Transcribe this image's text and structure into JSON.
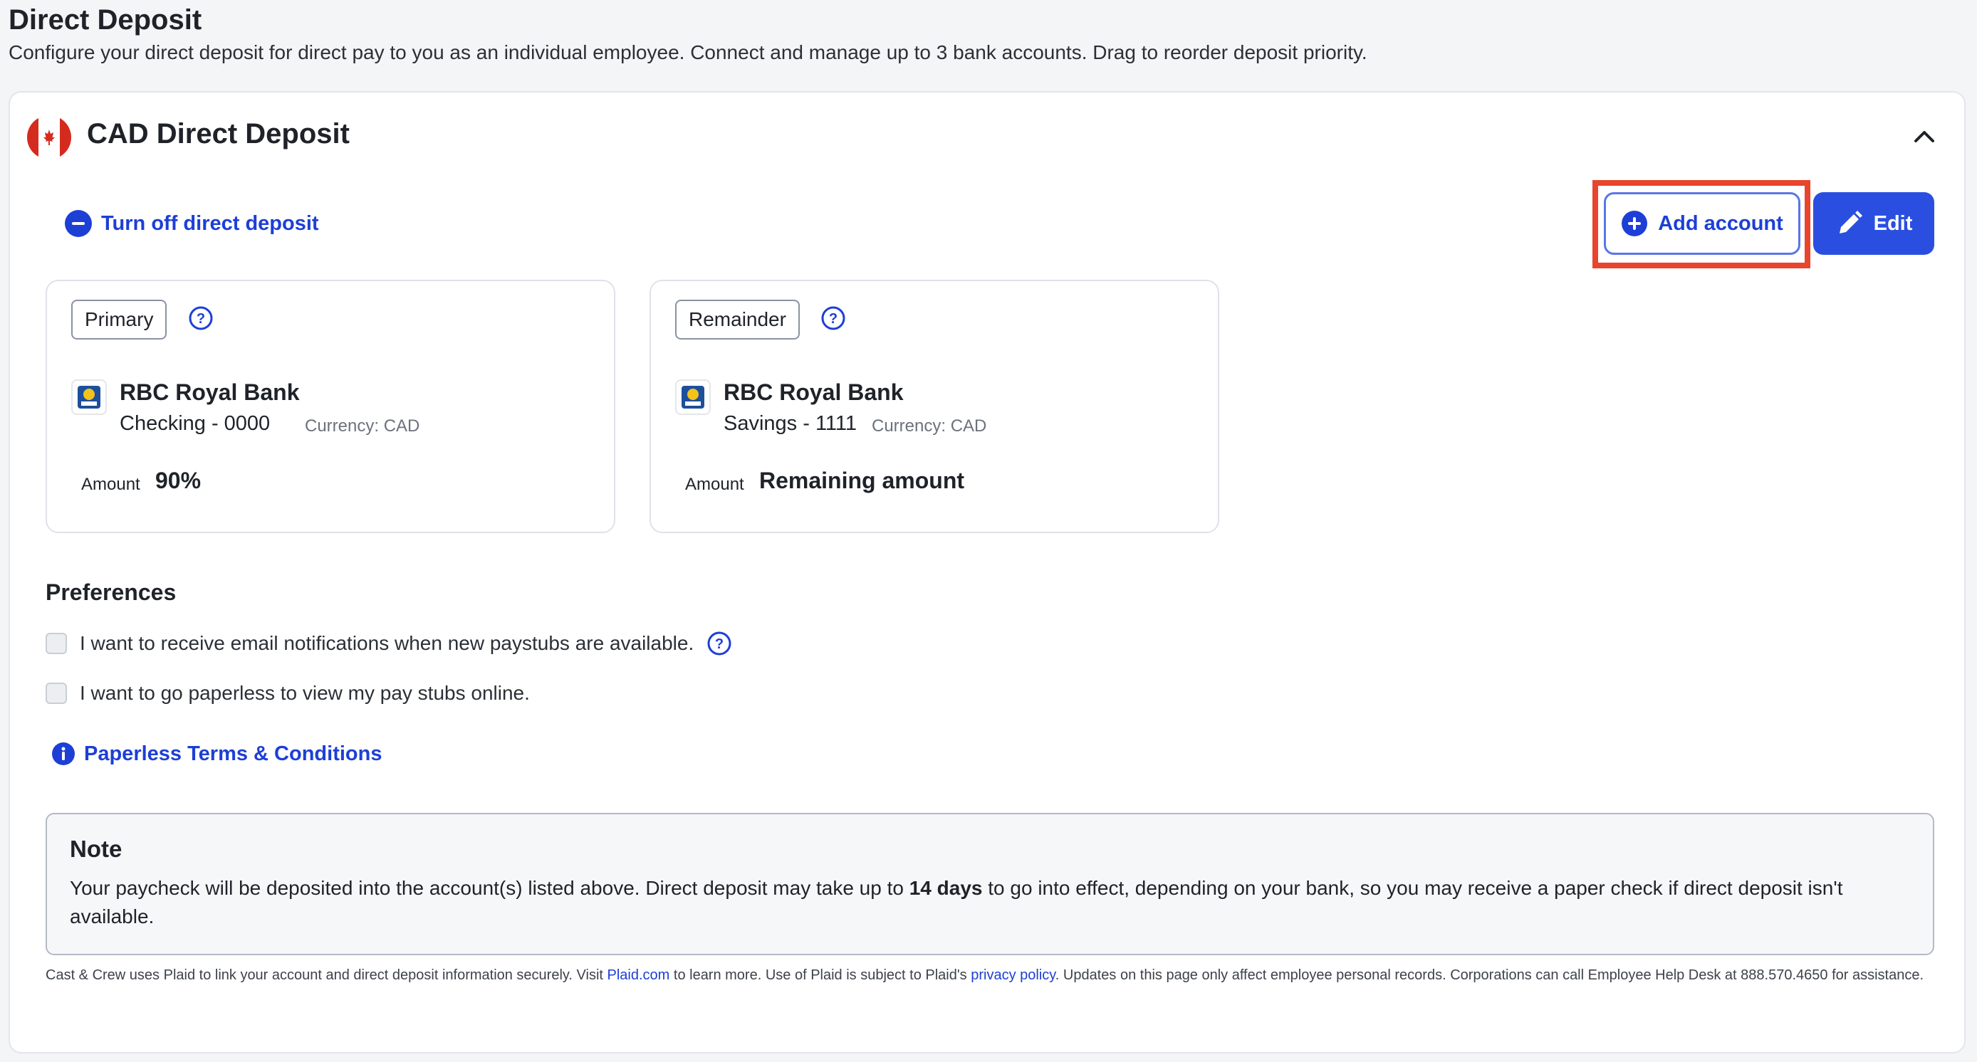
{
  "page": {
    "title": "Direct Deposit",
    "subtitle": "Configure your direct deposit for direct pay to you as an individual employee. Connect and manage up to 3 bank accounts. Drag to reorder deposit priority."
  },
  "section": {
    "title": "CAD Direct Deposit",
    "turn_off_label": "Turn off direct deposit",
    "add_account_label": "Add account",
    "edit_label": "Edit"
  },
  "accounts": [
    {
      "tag": "Primary",
      "bank_name": "RBC Royal Bank",
      "account": "Checking - 0000",
      "currency": "Currency: CAD",
      "amount_label": "Amount",
      "amount_value": "90%"
    },
    {
      "tag": "Remainder",
      "bank_name": "RBC Royal Bank",
      "account": "Savings - 1111",
      "currency": "Currency: CAD",
      "amount_label": "Amount",
      "amount_value": "Remaining amount"
    }
  ],
  "preferences": {
    "title": "Preferences",
    "email_notifications": "I want to receive email notifications when new paystubs are available.",
    "paperless": "I want to go paperless to view my pay stubs online.",
    "terms_link": "Paperless Terms & Conditions"
  },
  "note": {
    "title": "Note",
    "body_before": "Your paycheck will be deposited into the account(s) listed above. Direct deposit may take up to ",
    "body_bold": "14 days",
    "body_after": " to go into effect, depending on your bank, so you may receive a paper check if direct deposit isn't available."
  },
  "footer": {
    "part1": "Cast & Crew uses Plaid to link your account and direct deposit information securely. Visit ",
    "plaid_link": "Plaid.com",
    "part2": " to learn more. Use of Plaid is subject to Plaid's ",
    "privacy_link": "privacy policy",
    "part3": ". Updates on this page only affect employee personal records. Corporations can call Employee Help Desk at 888.570.4650 for assistance."
  },
  "colors": {
    "accent": "#2a4fe0",
    "link": "#1d3fd6",
    "highlight": "#e8452c",
    "flag_red": "#d52b1e"
  }
}
